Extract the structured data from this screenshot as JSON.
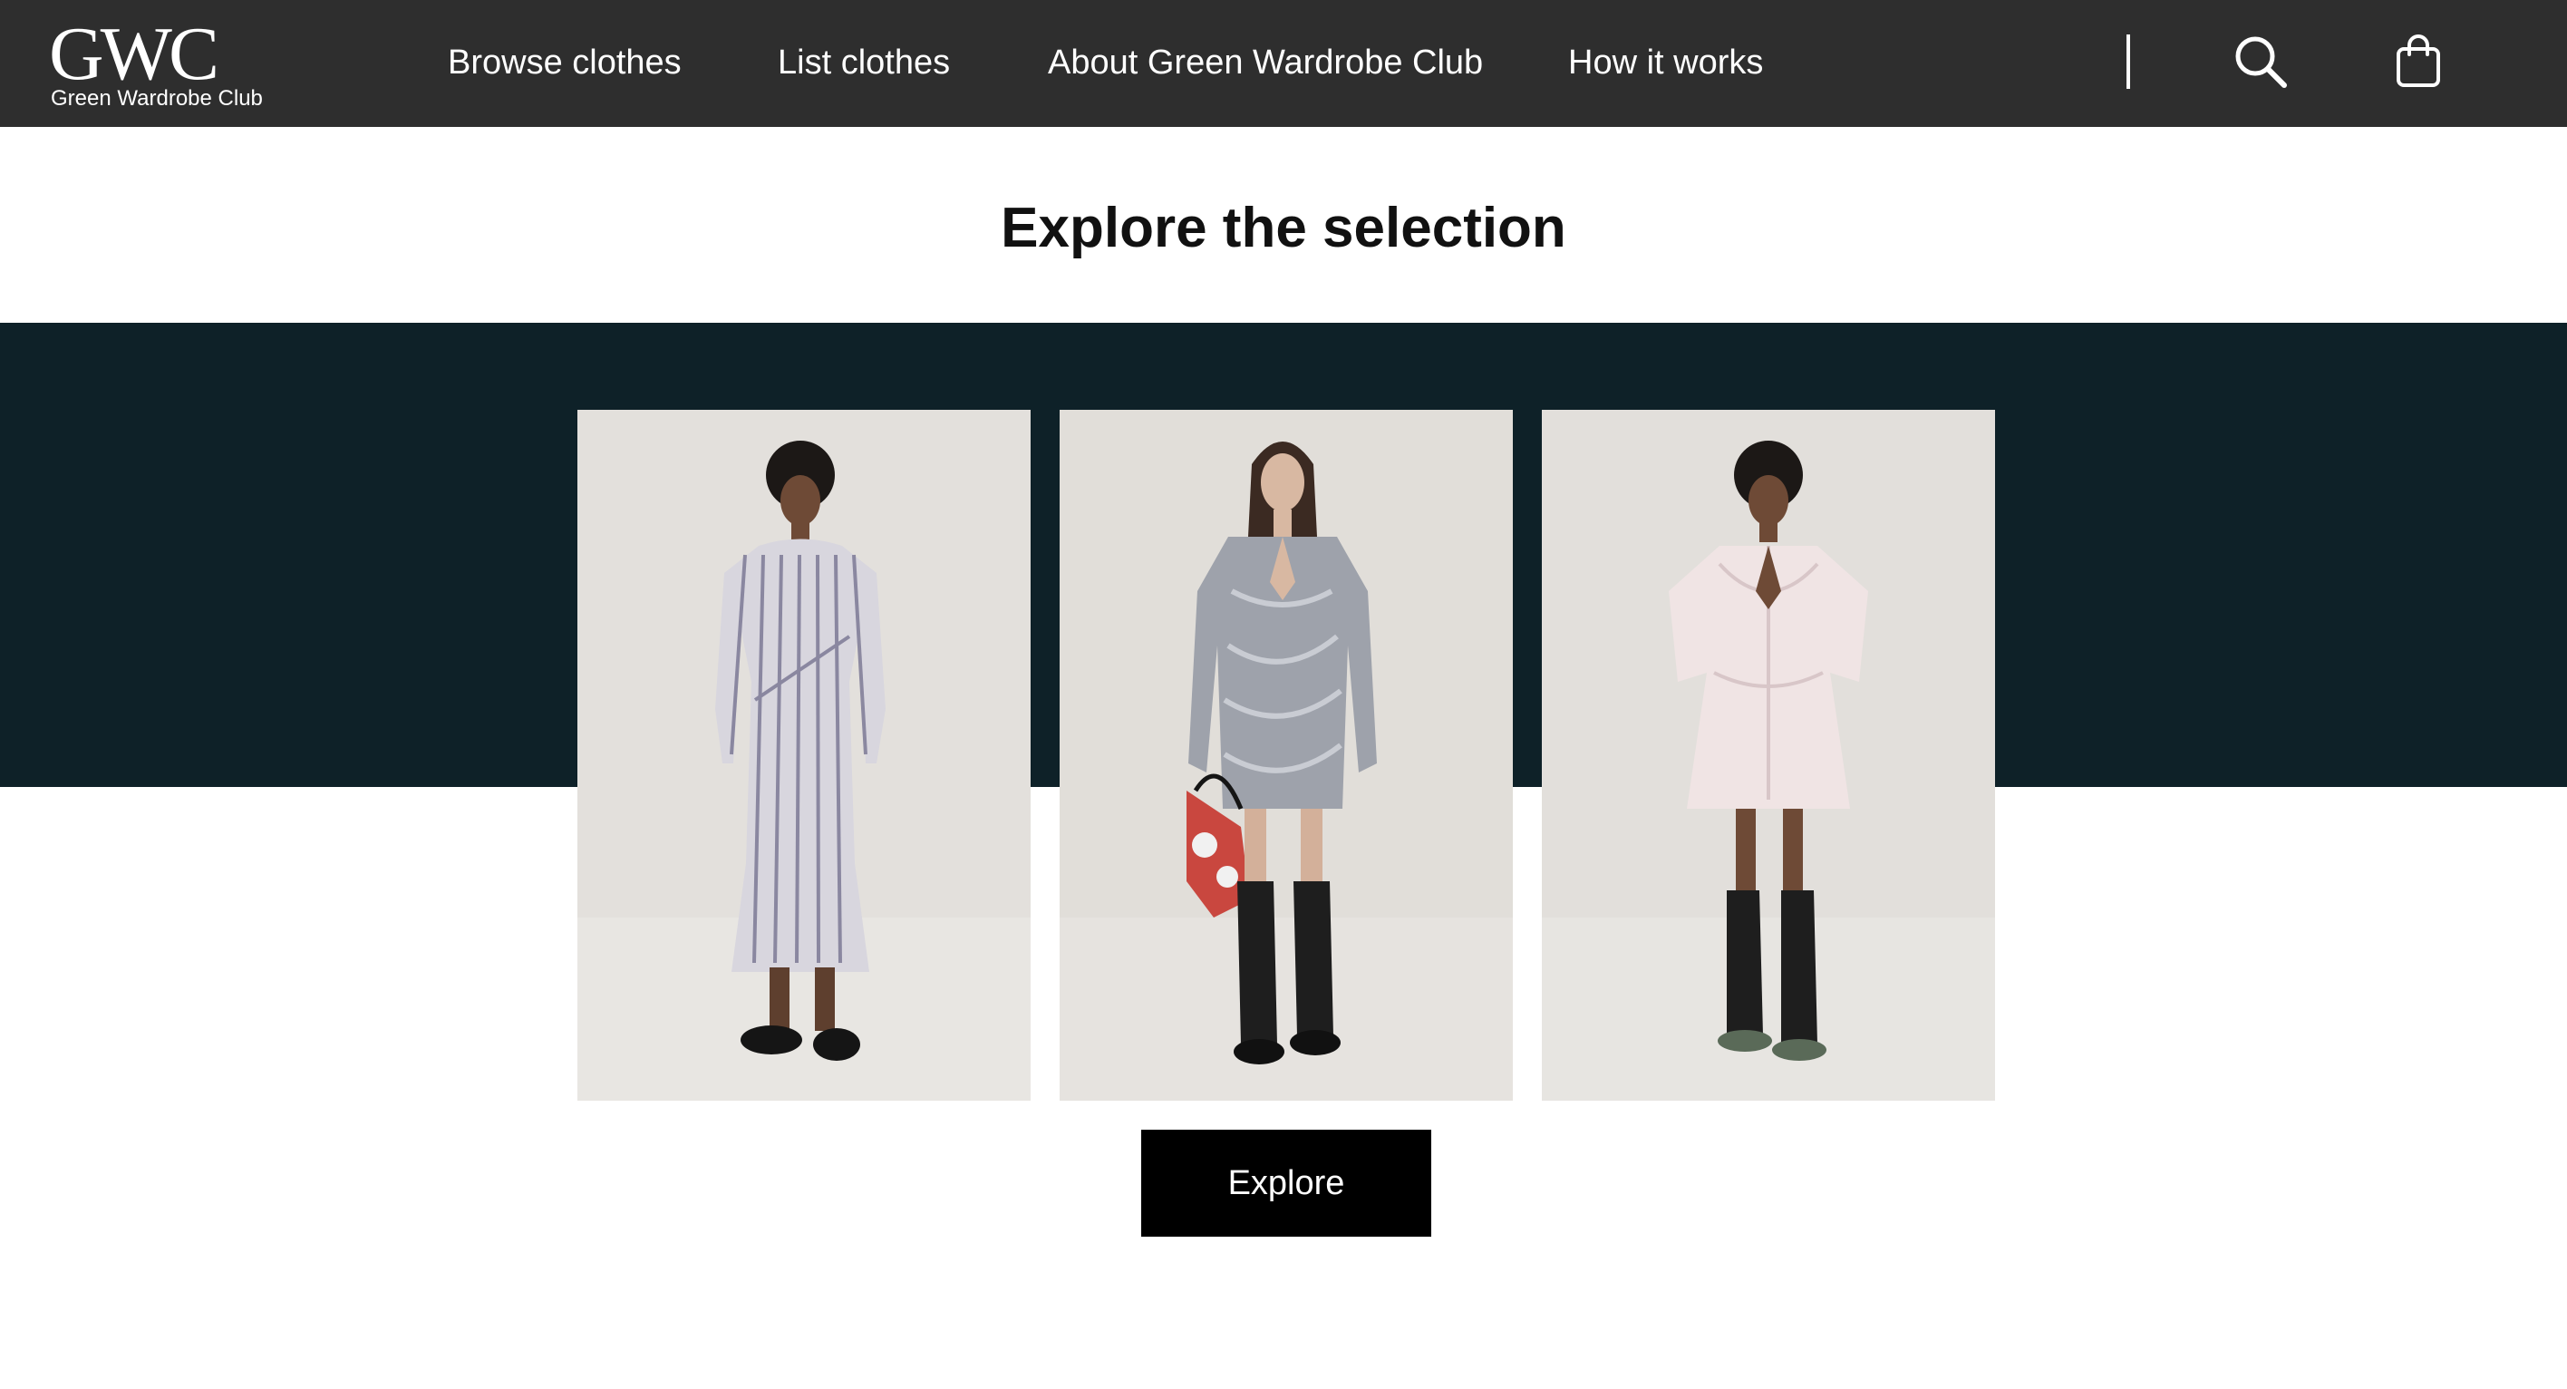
{
  "brand": {
    "mark": "GWC",
    "name": "Green Wardrobe Club"
  },
  "nav": {
    "items": [
      {
        "label": "Browse clothes"
      },
      {
        "label": "List clothes"
      },
      {
        "label": "About Green Wardrobe Club"
      },
      {
        "label": "How it works"
      }
    ],
    "icons": [
      "search-icon",
      "shopping-bag-icon"
    ]
  },
  "main": {
    "title": "Explore the selection",
    "explore_label": "Explore",
    "products": [
      {
        "image": "model in striped long-sleeve midi dress with loafers"
      },
      {
        "image": "model in grey ruched mini dress with black boots and floral bag"
      },
      {
        "image": "model in pale pink short-sleeve mini dress with black boots"
      }
    ]
  },
  "colors": {
    "navbar": "#2e2e2e",
    "band": "#0e2128",
    "button": "#000000",
    "photo_background": "#e4e1dd"
  }
}
